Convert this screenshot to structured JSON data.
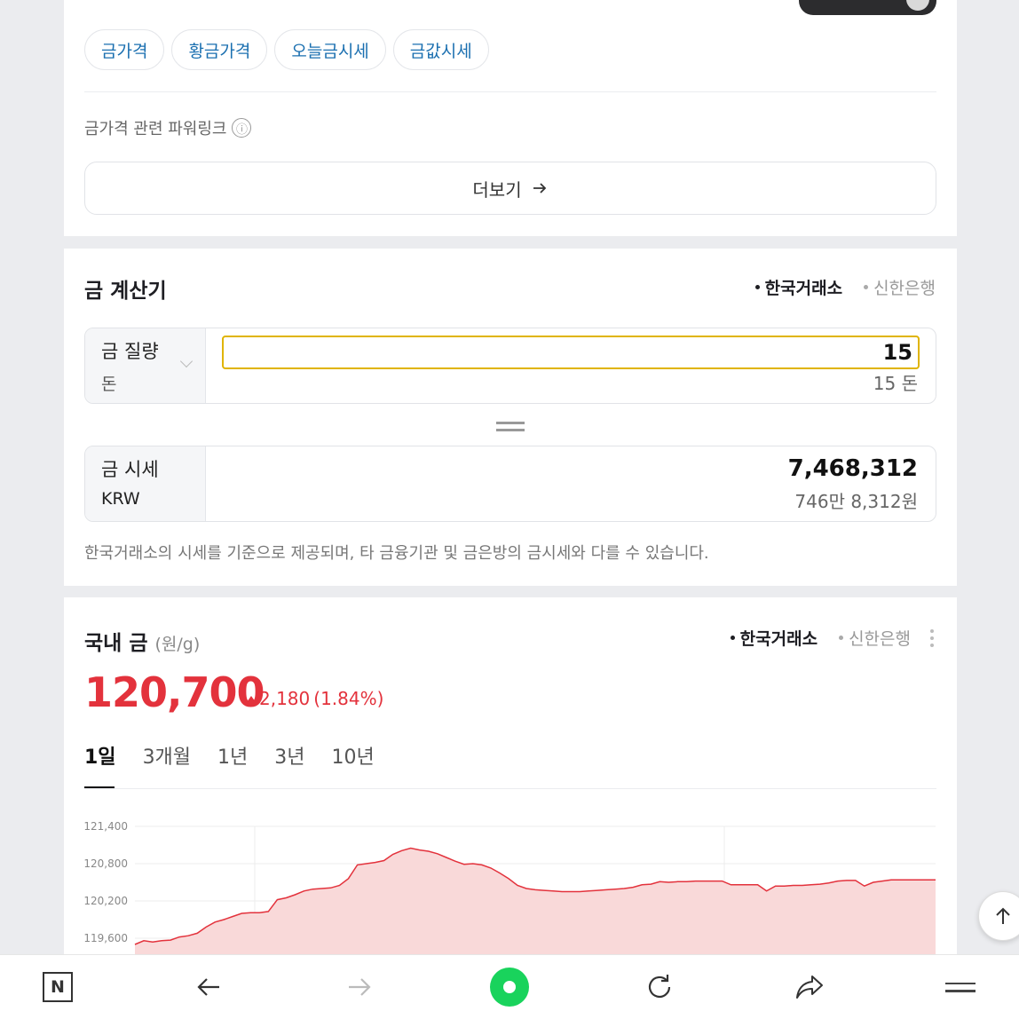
{
  "related_chips": [
    "금가격",
    "황금가격",
    "오늘금시세",
    "금값시세"
  ],
  "powerlink": {
    "label": "금가격 관련 파워링크",
    "info_icon": "ⓘ"
  },
  "more_button": {
    "label": "더보기",
    "icon": "arrow-right-icon"
  },
  "calculator": {
    "title": "금 계산기",
    "sources": {
      "active": "한국거래소",
      "inactive": "신한은행"
    },
    "quantity": {
      "label": "금 질량",
      "unit": "돈",
      "value": "15",
      "display": "15 돈"
    },
    "price": {
      "label": "금 시세",
      "currency": "KRW",
      "value": "7,468,312",
      "display": "746만 8,312원"
    },
    "disclaimer": "한국거래소의 시세를 기준으로 제공되며, 타 금융기관 및 금은방의 금시세와 다를 수 있습니다."
  },
  "domestic_gold": {
    "title": "국내 금",
    "unit": "(원/g)",
    "sources": {
      "active": "한국거래소",
      "inactive": "신한은행"
    },
    "price": "120,700",
    "change": "2,180",
    "change_pct": "(1.84%)",
    "change_color": "#e3323c",
    "periods": [
      "1일",
      "3개월",
      "1년",
      "3년",
      "10년"
    ],
    "selected_period": "1일"
  },
  "chart_data": {
    "type": "area",
    "y_ticks": [
      "121,400",
      "120,800",
      "120,200",
      "119,600"
    ],
    "y_tick_values": [
      121400,
      120800,
      120200,
      119600
    ],
    "ylim": [
      119400,
      121400
    ],
    "grid": true,
    "series": [
      {
        "color": "#e3323c",
        "values": [
          119500,
          119560,
          119540,
          119560,
          119570,
          119620,
          119640,
          119680,
          119780,
          119860,
          119900,
          119950,
          120000,
          120010,
          120010,
          120030,
          120220,
          120250,
          120300,
          120360,
          120390,
          120400,
          120410,
          120450,
          120560,
          120780,
          120800,
          120820,
          120850,
          120950,
          121010,
          121050,
          121020,
          121000,
          120960,
          120900,
          120840,
          120790,
          120800,
          120780,
          120730,
          120650,
          120560,
          120450,
          120400,
          120380,
          120370,
          120360,
          120350,
          120350,
          120350,
          120360,
          120370,
          120380,
          120390,
          120400,
          120420,
          120460,
          120470,
          120510,
          120500,
          120510,
          120510,
          120520,
          120520,
          120520,
          120520,
          120460,
          120460,
          120460,
          120460,
          120360,
          120440,
          120440,
          120450,
          120450,
          120460,
          120470,
          120490,
          120520,
          120530,
          120530,
          120440,
          120500,
          120520,
          120540,
          120540,
          120540,
          120540,
          120540,
          120540
        ]
      }
    ]
  },
  "bottom_bar": {
    "icons": [
      "naver-n-icon",
      "back-arrow-icon",
      "forward-arrow-icon",
      "green-dot-icon",
      "refresh-icon",
      "share-icon",
      "menu-icon"
    ],
    "n_label": "N"
  }
}
